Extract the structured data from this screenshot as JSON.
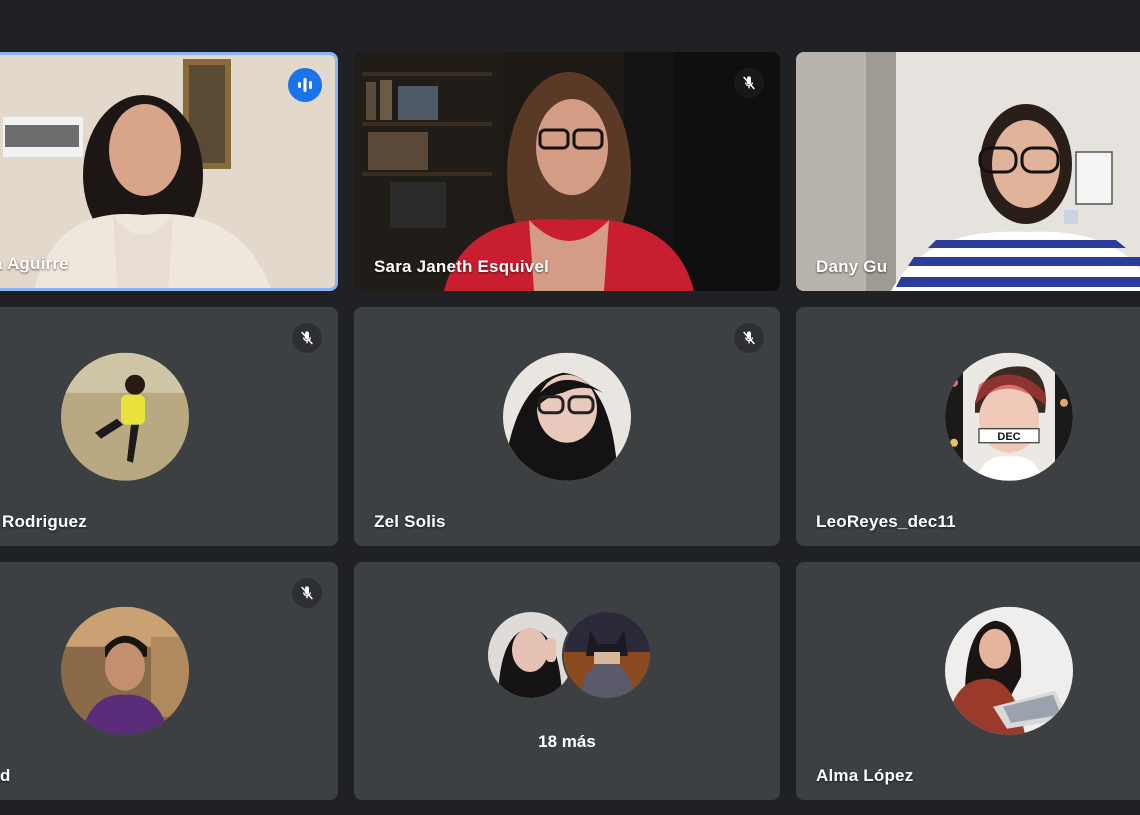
{
  "participants": [
    {
      "name": "a Aguirre",
      "status": "speaking",
      "type": "video",
      "speaking_icon": "audio-bars-icon"
    },
    {
      "name": "Sara Janeth Esquivel",
      "status": "muted",
      "type": "video",
      "mic_icon": "mic-off-icon"
    },
    {
      "name": "Dany Gu",
      "status": "unmuted",
      "type": "video"
    },
    {
      "name": "Rodriguez",
      "status": "muted",
      "type": "avatar",
      "mic_icon": "mic-off-icon"
    },
    {
      "name": "Zel Solis",
      "status": "muted",
      "type": "avatar",
      "mic_icon": "mic-off-icon"
    },
    {
      "name": "LeoReyes_dec11",
      "status": "unmuted",
      "type": "avatar",
      "avatar_text": "DEC"
    },
    {
      "name": "d",
      "status": "muted",
      "type": "avatar",
      "mic_icon": "mic-off-icon"
    },
    {
      "name": "Alma López",
      "status": "unmuted",
      "type": "avatar"
    }
  ],
  "overflow": {
    "label": "18 más"
  },
  "colors": {
    "background": "#202124",
    "tile": "#3c4043",
    "speaking_border": "#8ab4f8",
    "speaking_badge": "#1a73e8"
  }
}
